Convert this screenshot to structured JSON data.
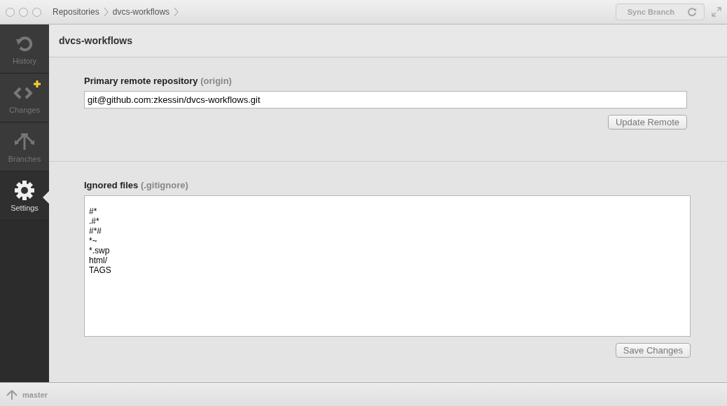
{
  "window": {
    "breadcrumbs": [
      "Repositories",
      "dvcs-workflows"
    ]
  },
  "toolbar": {
    "sync_button": {
      "label": "Sync Branch",
      "disabled": true
    }
  },
  "sidebar": {
    "items": [
      {
        "kind": "history",
        "label": "History",
        "selected": false,
        "new_changes": false
      },
      {
        "kind": "changes",
        "label": "Changes",
        "selected": false,
        "new_changes": true
      },
      {
        "kind": "branches",
        "label": "Branches",
        "selected": false,
        "new_changes": false
      },
      {
        "kind": "settings",
        "label": "Settings",
        "selected": true,
        "new_changes": false
      }
    ]
  },
  "header": {
    "title": "dvcs-workflows"
  },
  "remote": {
    "label": "Primary remote repository",
    "hint": "(origin)",
    "value": "git@github.com:zkessin/dvcs-workflows.git",
    "button": "Update Remote"
  },
  "ignored": {
    "label": "Ignored files",
    "hint": "(.gitignore)",
    "lines": [
      "#*",
      ".#*",
      "#*#",
      "*~",
      "*.swp",
      "html/",
      "TAGS"
    ],
    "button": "Save Changes"
  },
  "status_bar": {
    "branch": "master"
  }
}
